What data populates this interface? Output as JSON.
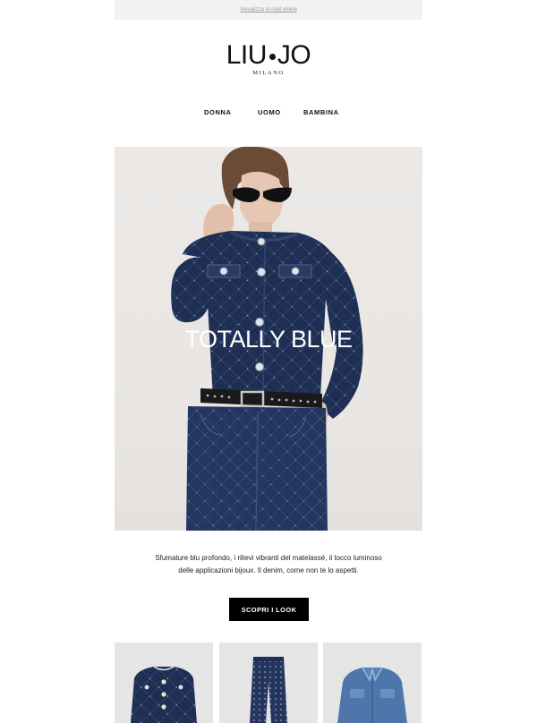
{
  "topbar": {
    "view_online": "Visualizza la mail online"
  },
  "brand": {
    "logo_left": "LIU",
    "logo_right": "JO",
    "tagline": "MILANO"
  },
  "nav": {
    "items": [
      "DONNA",
      "UOMO",
      "BAMBINA"
    ]
  },
  "hero": {
    "title": "TOTALLY BLUE"
  },
  "intro": {
    "text": "Sfumature blu profondo, i rilievi vibranti del matelassé, il tocco luminoso delle applicazioni bijoux. Il denim, come non te lo aspetti."
  },
  "cta": {
    "label": "SCOPRI I LOOK"
  },
  "colors": {
    "denim_dark": "#1e2d52",
    "denim_light": "#4d73a6",
    "topbar_bg": "#f2f2f2",
    "hero_bg": "#ebe8e6",
    "cta_bg": "#000000"
  },
  "icons": [
    "brand-logo",
    "model-photo",
    "quilted-jacket-photo",
    "dotted-jeans-photo",
    "denim-jacket-photo"
  ]
}
